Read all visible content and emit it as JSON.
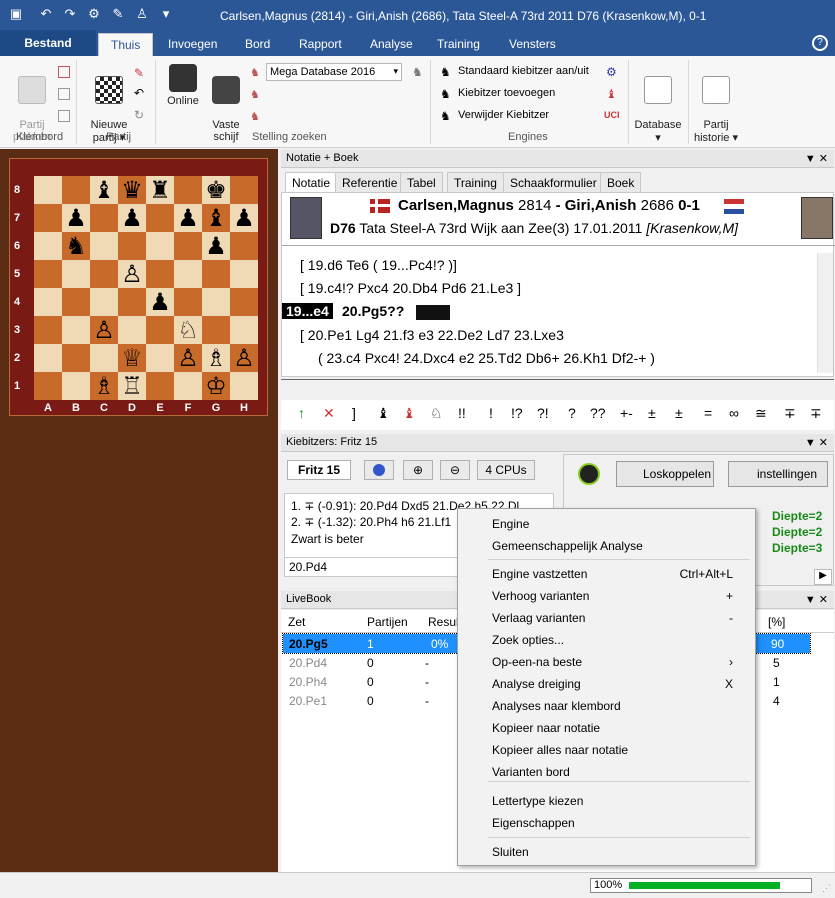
{
  "window": {
    "title": "Carlsen,Magnus (2814) - Giri,Anish (2686), Tata Steel-A 73rd 2011  D76  (Krasenkow,M), 0-1"
  },
  "menu": {
    "bestand": "Bestand",
    "tabs": [
      "Thuis",
      "Invoegen",
      "Bord",
      "Rapport",
      "Analyse",
      "Training",
      "Vensters"
    ]
  },
  "ribbon": {
    "partij_plakken": "Partij\nplakken",
    "klembord": "Klembord",
    "nieuwe_partij": "Nieuwe\npartij ▾",
    "partij": "Partij",
    "online": "Online",
    "vaste_schijf": "Vaste\nschijf",
    "database_select": "Mega Database 2016",
    "stelling_zoeken": "Stelling zoeken",
    "kib1": "Standaard kiebitzer aan/uit",
    "kib2": "Kiebitzer toevoegen",
    "kib3": "Verwijder Kiebitzer",
    "engines": "Engines",
    "database": "Database\n▾",
    "partij_historie": "Partij\nhistorie ▾"
  },
  "board": {
    "ranks": [
      "8",
      "7",
      "6",
      "5",
      "4",
      "3",
      "2",
      "1"
    ],
    "files": [
      "A",
      "B",
      "C",
      "D",
      "E",
      "F",
      "G",
      "H"
    ],
    "rows": [
      [
        "",
        "",
        "♝",
        "♛",
        "♜",
        "",
        "♚",
        ""
      ],
      [
        "",
        "♟",
        "",
        "♟",
        "",
        "♟",
        "♝",
        "♟"
      ],
      [
        "",
        "♞",
        "",
        "",
        "",
        "",
        "♟",
        ""
      ],
      [
        "",
        "",
        "",
        "♙",
        "",
        "",
        "",
        ""
      ],
      [
        "",
        "",
        "",
        "",
        "♟",
        "",
        "",
        ""
      ],
      [
        "",
        "",
        "♙",
        "",
        "",
        "♘",
        "",
        ""
      ],
      [
        "",
        "",
        "",
        "♕",
        "",
        "♙",
        "♗",
        "♙"
      ],
      [
        "",
        "",
        "♗",
        "♖",
        "",
        "",
        "♔",
        ""
      ]
    ]
  },
  "notation_panel": {
    "header": "Notatie + Boek",
    "tabs": [
      "Notatie",
      "Referentie",
      "Tabel",
      "Training",
      "Schaakformulier",
      "Boek"
    ],
    "white_name": "Carlsen,Magnus",
    "white_elo": "2814",
    "sep": "-",
    "black_name": "Giri,Anish",
    "black_elo": "2686",
    "result": "0-1",
    "eco": "D76",
    "event": "Tata Steel-A 73rd Wijk aan Zee(3) 17.01.2011",
    "annotator": "[Krasenkow,M]",
    "line1": "[ 19.d6  Te6  ( 19...Pc4!? )]",
    "line2": "[ 19.c4!?  Pxc4  20.Db4  Pd6  21.Le3 ]",
    "cur_move": "19...e4",
    "cur_next": "20.Pg5??",
    "line4": "[ 20.Pe1  Lg4  21.f3  e3  22.De2  Ld7  23.Lxe3",
    "line5": "( 23.c4  Pxc4!  24.Dxc4  e2  25.Td2  Db6+  26.Kh1  Df2-+ )"
  },
  "annot_symbols": [
    "↑",
    "✕",
    "]",
    "♝",
    "♝",
    "♘",
    "!!",
    "!",
    "!?",
    "?!",
    "?",
    "??",
    "+-",
    "±",
    "±",
    "=",
    "∞",
    "≅",
    "∓",
    "∓"
  ],
  "kibitz": {
    "header": "Kiebitzers: Fritz 15",
    "engine": "Fritz 15",
    "cpus": "4 CPUs",
    "loskoppelen": "Loskoppelen",
    "instellingen": "instellingen",
    "line1": "1. ∓ (-0.91): 20.Pd4 Dxd5 21.De2 h5 22.Dl",
    "line2": "2. ∓ (-1.32): 20.Ph4 h6 21.Lf1",
    "line3": "Zwart is beter",
    "input": "20.Pd4",
    "diepte": [
      "Diepte=2",
      "Diepte=2",
      "Diepte=3"
    ]
  },
  "livebook": {
    "header": "LiveBook",
    "cols": [
      "Zet",
      "Partijen",
      "Resul",
      "[%]"
    ],
    "rows": [
      {
        "zet": "20.Pg5",
        "partijen": "1",
        "resul": "0%",
        "pct": "90"
      },
      {
        "zet": "20.Pd4",
        "partijen": "0",
        "resul": "-",
        "pct": "5"
      },
      {
        "zet": "20.Ph4",
        "partijen": "0",
        "resul": "-",
        "pct": "1"
      },
      {
        "zet": "20.Pe1",
        "partijen": "0",
        "resul": "-",
        "pct": "4"
      }
    ]
  },
  "context_menu": {
    "items": [
      {
        "label": "Engine",
        "shortcut": ""
      },
      {
        "label": "Gemeenschappelijk Analyse",
        "shortcut": ""
      },
      {
        "label": "Engine vastzetten",
        "shortcut": "Ctrl+Alt+L"
      },
      {
        "label": "Verhoog varianten",
        "shortcut": "+"
      },
      {
        "label": "Verlaag varianten",
        "shortcut": "-"
      },
      {
        "label": "Zoek opties...",
        "shortcut": ""
      },
      {
        "label": "Op-een-na beste",
        "shortcut": "›"
      },
      {
        "label": "Analyse dreiging",
        "shortcut": "X"
      },
      {
        "label": "Analyses naar klembord",
        "shortcut": ""
      },
      {
        "label": "Kopieer naar notatie",
        "shortcut": ""
      },
      {
        "label": "Kopieer alles naar notatie",
        "shortcut": ""
      },
      {
        "label": "Varianten bord",
        "shortcut": ""
      },
      {
        "label": "Lettertype kiezen",
        "shortcut": ""
      },
      {
        "label": "Eigenschappen",
        "shortcut": ""
      },
      {
        "label": "Sluiten",
        "shortcut": ""
      }
    ]
  },
  "status": {
    "zoom": "100%",
    "progress": 0.85
  },
  "colors": {
    "title_bg": "#2b5797",
    "light_sq": "#f0d9b5",
    "dark_sq": "#c76a2a",
    "selected": "#1e90ff",
    "green_text": "#1a8a1a"
  }
}
